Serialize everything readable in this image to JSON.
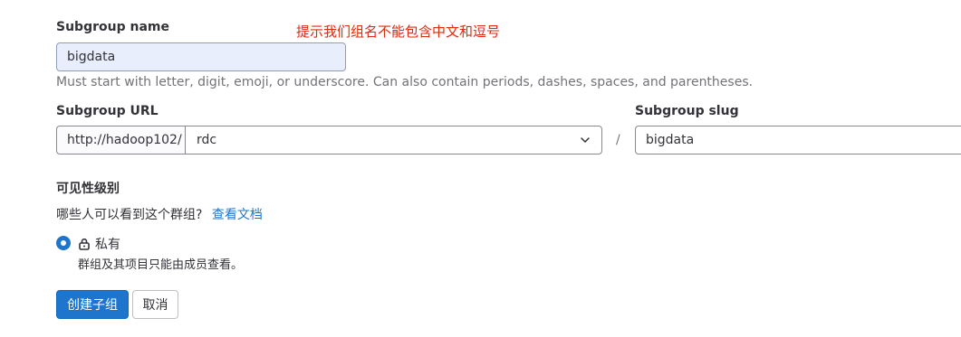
{
  "subgroup_name": {
    "label": "Subgroup name",
    "value": "bigdata",
    "annotation": "提示我们组名不能包含中文和逗号",
    "help": "Must start with letter, digit, emoji, or underscore. Can also contain periods, dashes, spaces, and parentheses."
  },
  "subgroup_url": {
    "label": "Subgroup URL",
    "prefix": "http://hadoop102/",
    "selected": "rdc",
    "separator": "/"
  },
  "subgroup_slug": {
    "label": "Subgroup slug",
    "value": "bigdata"
  },
  "visibility": {
    "label": "可见性级别",
    "question": "哪些人可以看到这个群组?",
    "docs_link": "查看文档",
    "option": {
      "label": "私有",
      "description": "群组及其项目只能由成员查看。",
      "checked": true,
      "icon": "lock-icon"
    }
  },
  "actions": {
    "create": "创建子组",
    "cancel": "取消"
  },
  "colors": {
    "primary": "#1f75cb",
    "annotation": "#dd2b0e",
    "focused_input_bg": "#e8eefb"
  }
}
